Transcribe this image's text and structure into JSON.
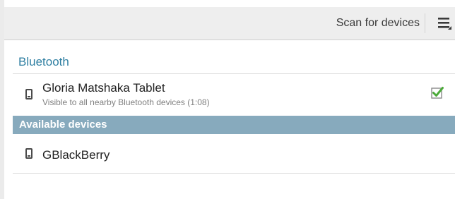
{
  "action_bar": {
    "scan_label": "Scan for devices",
    "overflow_icon": "overflow-menu-icon"
  },
  "bluetooth_section": {
    "title": "Bluetooth"
  },
  "my_device": {
    "name": "Gloria Matshaka Tablet",
    "status": "Visible to all nearby Bluetooth devices (1:08)",
    "visible_checked": true,
    "icon": "phone-icon"
  },
  "available_section": {
    "title": "Available devices",
    "items": [
      {
        "name": "GBlackBerry",
        "icon": "phone-icon"
      }
    ]
  },
  "colors": {
    "accent": "#2f7fa2",
    "section_header_bg": "#87aabd",
    "checkbox_check": "#4caa3a",
    "action_bar_bg": "#eeeeee"
  }
}
